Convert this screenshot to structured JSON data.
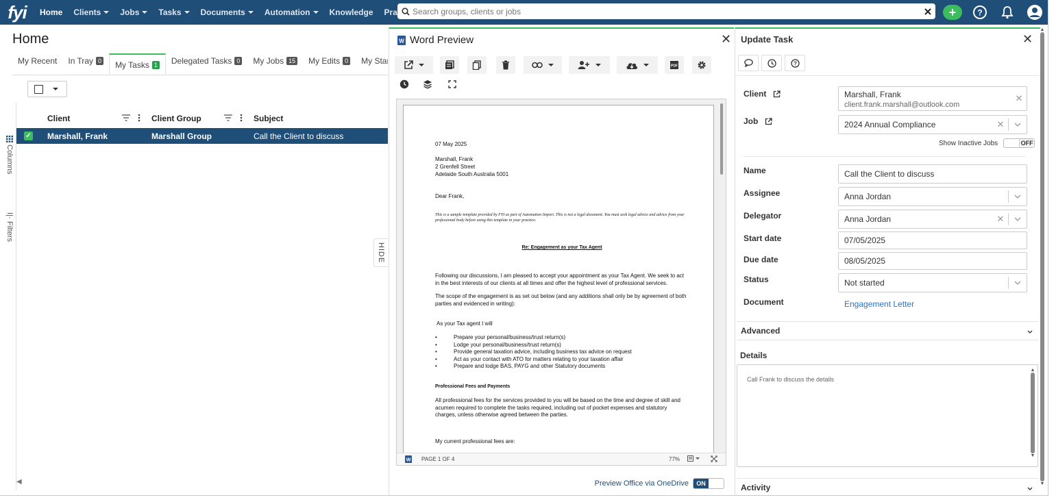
{
  "topnav": {
    "logo": "fyi",
    "items": [
      {
        "label": "Home",
        "caret": false
      },
      {
        "label": "Clients",
        "caret": true
      },
      {
        "label": "Jobs",
        "caret": true
      },
      {
        "label": "Tasks",
        "caret": true
      },
      {
        "label": "Documents",
        "caret": true
      },
      {
        "label": "Automation",
        "caret": true
      },
      {
        "label": "Knowledge",
        "caret": false
      },
      {
        "label": "Practice",
        "caret": false
      }
    ],
    "search_placeholder": "Search groups, clients or jobs",
    "accent": "#3dbb5f",
    "bar_color": "#1f4e79"
  },
  "home": {
    "title": "Home",
    "tabs": [
      {
        "label": "My Recent",
        "badge": ""
      },
      {
        "label": "In Tray",
        "badge": "0"
      },
      {
        "label": "My Tasks",
        "badge": "1"
      },
      {
        "label": "Delegated Tasks",
        "badge": "0"
      },
      {
        "label": "My Jobs",
        "badge": "15"
      },
      {
        "label": "My Edits",
        "badge": "0"
      },
      {
        "label": "My Starred",
        "badge": ""
      }
    ],
    "rail": {
      "columns": "Columns",
      "filters": "Filters"
    },
    "grid": {
      "headers": [
        "Client",
        "Client Group",
        "Subject"
      ],
      "rows": [
        {
          "client": "Marshall, Frank",
          "group": "Marshall Group",
          "subject": "Call the Client to discuss"
        }
      ]
    },
    "hide_label": "HIDE"
  },
  "word_preview": {
    "title": "Word Preview",
    "doc": {
      "date": "07 May 2025",
      "addr1": "Marshall, Frank",
      "addr2": "2 Grenfell Street",
      "addr3": "Adelaide South Australia 5001",
      "salutation": "Dear Frank,",
      "disclaimer": "This is a sample template provided by FYI as part of Automation Import. This is not a legal document. You must seek legal advice and advice from your professional body before using this template in your practice.",
      "heading": "Re: Engagement as your Tax Agent",
      "para1": "Following our discussions, I am pleased to accept your appointment as your Tax Agent.  We seek to act in the best interests of our clients at all times and offer the highest level of professional services.",
      "para2": "The scope of the engagement is as set out below (and any additions shall only be by agreement of both parties and evidenced in writing):",
      "intro": "As your Tax agent I will",
      "bullets": [
        "Prepare your personal/business/trust return(s)",
        "Lodge your personal/business/trust return(s)",
        "Provide general taxation advice, including business tax advice on request",
        "Act as your contact with ATO for matters relating to your taxation affair",
        "Prepare and lodge BAS, PAYG and other Statutory documents"
      ],
      "fees_heading": "Professional Fees and Payments",
      "fees_para": "All professional fees for the services provided to you will be based on the time and degree of skill and acumen required to complete the tasks required, including out of pocket expenses and statutory charges, unless otherwise agreed between the parties.",
      "fees_current": "My current professional fees are:"
    },
    "status": {
      "page": "PAGE 1 OF 4",
      "zoom": "77%"
    },
    "onedrive_label": "Preview Office via OneDrive",
    "onedrive_state": "ON"
  },
  "update_task": {
    "title": "Update Task",
    "client_label": "Client",
    "client_name": "Marshall, Frank",
    "client_email": "client.frank.marshall@outlook.com",
    "job_label": "Job",
    "job_value": "2024 Annual Compliance",
    "inactive_label": "Show Inactive Jobs",
    "inactive_state": "OFF",
    "name_label": "Name",
    "name_value": "Call the Client to discuss",
    "assignee_label": "Assignee",
    "assignee_value": "Anna Jordan",
    "delegator_label": "Delegator",
    "delegator_value": "Anna Jordan",
    "start_label": "Start date",
    "start_value": "07/05/2025",
    "due_label": "Due date",
    "due_value": "08/05/2025",
    "status_label": "Status",
    "status_value": "Not started",
    "document_label": "Document",
    "document_value": "Engagement Letter",
    "advanced_label": "Advanced",
    "details_label": "Details",
    "details_value": "Call Frank to discuss the details",
    "activity_label": "Activity"
  }
}
